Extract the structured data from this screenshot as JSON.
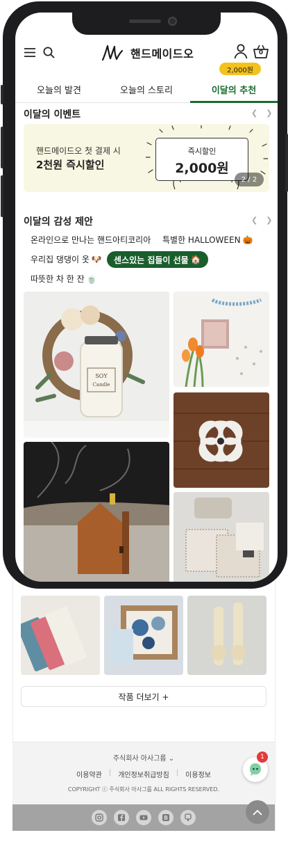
{
  "brand": {
    "name": "핸드메이드오"
  },
  "header": {
    "points_badge": "2,000원",
    "cart_count": "0"
  },
  "tabs": [
    {
      "label": "오늘의 발견",
      "active": false
    },
    {
      "label": "오늘의 스토리",
      "active": false
    },
    {
      "label": "이달의 추천",
      "active": true
    }
  ],
  "events": {
    "title": "이달의 이벤트",
    "banner_line1": "핸드메이드오 첫 결제 시",
    "banner_line2": "2천원 즉시할인",
    "coupon_label": "즉시할인",
    "coupon_amount": "2,000원",
    "slide_counter": "2 / 2"
  },
  "suggestions": {
    "title": "이달의 감성 제안",
    "chips": [
      {
        "label": "온라인으로 만나는 핸드아티코리아",
        "emoji": "",
        "selected": false
      },
      {
        "label": "특별한 HALLOWEEN",
        "emoji": "🎃",
        "selected": false
      },
      {
        "label": "우리집 댕댕이 옷",
        "emoji": "🐶",
        "selected": false
      },
      {
        "label": "센스있는 집들이 선물",
        "emoji": "🏠",
        "selected": true
      },
      {
        "label": "따뜻한 차 한 잔",
        "emoji": "🍵",
        "selected": false
      }
    ]
  },
  "product_images": {
    "candle_label": "SOY Candle",
    "alt_1": "wreath and soy candle",
    "alt_2": "tulips and frame",
    "alt_3": "knot coaster",
    "alt_4": "wooden incense house",
    "alt_5": "fabric coasters",
    "alt_6": "towels",
    "alt_7": "gift box",
    "alt_8": "ceramic figures"
  },
  "more_button": "작품 더보기 +",
  "footer": {
    "company": "주식회사 아사그룹",
    "links": [
      "이용약관",
      "개인정보취급방침",
      "이용정보"
    ],
    "copyright": "COPYRIGHT ⓒ 주식회사 아사그룹 ALL RIGHTS RESERVED."
  },
  "chat": {
    "badge": "1"
  },
  "social_icons": [
    "instagram-icon",
    "facebook-icon",
    "youtube-icon",
    "blog-icon",
    "store-icon"
  ],
  "colors": {
    "accent_green": "#1a6b2e",
    "badge_yellow": "#f4c21f",
    "banner_bg": "#f8f7e3"
  }
}
